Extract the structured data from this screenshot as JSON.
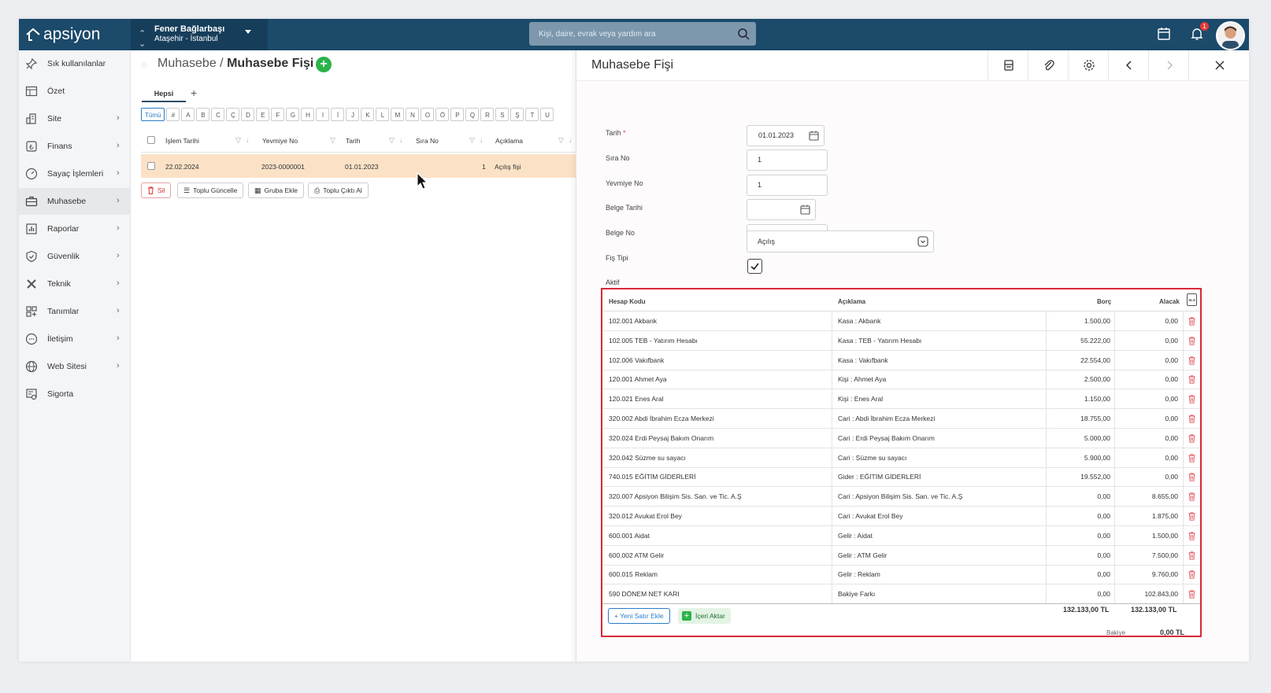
{
  "brand": {
    "name": "apsiyon"
  },
  "site_selector": {
    "name": "Fener Bağlarbaşı",
    "location": "Ataşehir - İstanbul"
  },
  "search": {
    "placeholder": "Kişi, daire, evrak veya yardım ara"
  },
  "notifications": {
    "count": "1"
  },
  "sidebar": {
    "items": [
      {
        "label": "Sık kullanılanlar",
        "icon": "pin-icon",
        "arrow": false
      },
      {
        "label": "Özet",
        "icon": "table-icon",
        "arrow": false
      },
      {
        "label": "Site",
        "icon": "building-icon",
        "arrow": true
      },
      {
        "label": "Finans",
        "icon": "lira-icon",
        "arrow": true
      },
      {
        "label": "Sayaç İşlemleri",
        "icon": "gauge-icon",
        "arrow": true
      },
      {
        "label": "Muhasebe",
        "icon": "briefcase-icon",
        "arrow": true
      },
      {
        "label": "Raporlar",
        "icon": "chart-icon",
        "arrow": true
      },
      {
        "label": "Güvenlik",
        "icon": "shield-icon",
        "arrow": true
      },
      {
        "label": "Teknik",
        "icon": "tools-icon",
        "arrow": true
      },
      {
        "label": "Tanımlar",
        "icon": "grid-plus-icon",
        "arrow": true
      },
      {
        "label": "İletişim",
        "icon": "chat-icon",
        "arrow": true
      },
      {
        "label": "Web Sitesi",
        "icon": "globe-icon",
        "arrow": true
      },
      {
        "label": "Sigorta",
        "icon": "insurance-icon",
        "arrow": false
      }
    ],
    "active": "Muhasebe"
  },
  "breadcrumb": {
    "parent": "Muhasebe / ",
    "current": "Muhasebe Fişi"
  },
  "list": {
    "tab": "Hepsi",
    "letters": [
      "Tümü",
      "#",
      "A",
      "B",
      "C",
      "Ç",
      "D",
      "E",
      "F",
      "G",
      "H",
      "I",
      "İ",
      "J",
      "K",
      "L",
      "M",
      "N",
      "O",
      "Ö",
      "P",
      "Q",
      "R",
      "S",
      "Ş",
      "T",
      "U"
    ],
    "columns": {
      "date": "İşlem Tarihi",
      "journal": "Yevmiye No",
      "tarih": "Tarih",
      "sira": "Sıra No",
      "desc": "Açıklama"
    },
    "row": {
      "date": "22.02.2024",
      "journal": "2023-0000001",
      "tarih": "01.01.2023",
      "sira": "1",
      "desc": "Açılış fişi"
    },
    "actions": {
      "delete": "Sil",
      "bulk_update": "Toplu Güncelle",
      "add_group": "Gruba Ekle",
      "bulk_print": "Toplu Çıktı Al"
    }
  },
  "panel": {
    "title": "Muhasebe Fişi",
    "form": {
      "tarih_label": "Tarih",
      "tarih_value": "01.01.2023",
      "sira_label": "Sıra No",
      "sira_value": "1",
      "yevmiye_label": "Yevmiye No",
      "yevmiye_value": "1",
      "belge_tarihi_label": "Belge Tarihi",
      "belge_tarihi_value": "",
      "belge_no_label": "Belge No",
      "belge_no_value": "",
      "fis_tipi_label": "Fiş Tipi",
      "fis_tipi_value": "Açılış",
      "aktif_label": "Aktif",
      "aktif_checked": true
    },
    "grid": {
      "headers": {
        "code": "Hesap Kodu",
        "desc": "Açıklama",
        "debit": "Borç",
        "credit": "Alacak",
        "xls": "XLS"
      },
      "rows": [
        {
          "code": "102.001 Akbank",
          "desc": "Kasa : Akbank",
          "debit": "1.500,00",
          "credit": "0,00"
        },
        {
          "code": "102.005 TEB - Yatırım Hesabı",
          "desc": "Kasa : TEB - Yatırım Hesabı",
          "debit": "55.222,00",
          "credit": "0,00"
        },
        {
          "code": "102.006 Vakıfbank",
          "desc": "Kasa : Vakıfbank",
          "debit": "22.554,00",
          "credit": "0,00"
        },
        {
          "code": "120.001 Ahmet Aya",
          "desc": "Kişi : Ahmet Aya",
          "debit": "2.500,00",
          "credit": "0,00"
        },
        {
          "code": "120.021 Enes Aral",
          "desc": "Kişi : Enes Aral",
          "debit": "1.150,00",
          "credit": "0,00"
        },
        {
          "code": "320.002 Abdi İbrahim Ecza Merkezi",
          "desc": "Cari : Abdi İbrahim Ecza Merkezi",
          "debit": "18.755,00",
          "credit": "0,00"
        },
        {
          "code": "320.024 Erdi Peysaj Bakım Onarım",
          "desc": "Cari : Erdi Peysaj Bakım Onarım",
          "debit": "5.000,00",
          "credit": "0,00"
        },
        {
          "code": "320.042 Süzme su sayacı",
          "desc": "Cari : Süzme su sayacı",
          "debit": "5.900,00",
          "credit": "0,00"
        },
        {
          "code": "740.015 EĞİTİM GİDERLERİ",
          "desc": "Gider : EĞİTİM GİDERLERİ",
          "debit": "19.552,00",
          "credit": "0,00"
        },
        {
          "code": "320.007 Apsiyon Bilişim Sis. San. ve Tic. A.Ş",
          "desc": "Cari : Apsiyon Bilişim Sis. San. ve Tic. A.Ş",
          "debit": "0,00",
          "credit": "8.655,00"
        },
        {
          "code": "320.012 Avukat Erol Bey",
          "desc": "Cari : Avukat Erol Bey",
          "debit": "0,00",
          "credit": "1.875,00"
        },
        {
          "code": "600.001 Aidat",
          "desc": "Gelir : Aidat",
          "debit": "0,00",
          "credit": "1.500,00"
        },
        {
          "code": "600.002 ATM Gelir",
          "desc": "Gelir : ATM Gelir",
          "debit": "0,00",
          "credit": "7.500,00"
        },
        {
          "code": "600.015 Reklam",
          "desc": "Gelir : Reklam",
          "debit": "0,00",
          "credit": "9.760,00"
        },
        {
          "code": "590 DÖNEM NET KARI",
          "desc": "Bakiye Farkı",
          "debit": "0,00",
          "credit": "102.843,00"
        }
      ],
      "new_row_label": "Yeni Satır Ekle",
      "import_label": "İçeri Aktar",
      "total_debit": "132.133,00 TL",
      "total_credit": "132.133,00 TL",
      "balance_label": "Bakiye",
      "balance_value": "0,00 TL"
    }
  },
  "colors": {
    "topbar": "#1b4a6b",
    "accent_green": "#2bb34a",
    "selected_row": "#fbe2c6",
    "grid_border": "#d8283a"
  }
}
